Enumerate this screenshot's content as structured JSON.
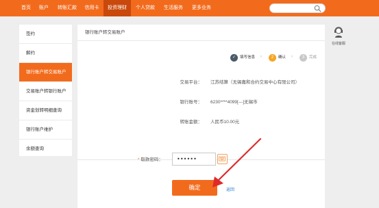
{
  "nav": {
    "items": [
      "首页",
      "账户",
      "转账汇款",
      "信用卡",
      "投资理财",
      "个人贷款",
      "生活服务",
      "更多业务"
    ],
    "active_index": 4
  },
  "search": {
    "placeholder": ""
  },
  "sidebar": {
    "items": [
      "签约",
      "解约",
      "银行账户转交易账户",
      "交易账户转银行账户",
      "资金划转明细查询",
      "银行账户维护",
      "余额查询"
    ],
    "active_index": 2
  },
  "panel": {
    "title": "银行账户转交易账户",
    "steps": [
      {
        "num": "✓",
        "label": "填写信息",
        "state": "done"
      },
      {
        "num": "2",
        "label": "确认",
        "state": "current"
      },
      {
        "num": "3",
        "label": "完成",
        "state": "pending"
      }
    ],
    "info": [
      {
        "label": "交易平台：",
        "value": "江苏结算（无锡嘉和合约交易中心有限公司）"
      },
      {
        "label": "银行账号：",
        "value": "6230****4099[---]无锡市"
      },
      {
        "label": "转账金额：",
        "value": "人民币10.00元"
      }
    ],
    "password": {
      "label": "取款密码：",
      "value": "••••••"
    },
    "confirm_label": "确定",
    "back_label": "返回"
  },
  "cs": {
    "label": "在线客服"
  },
  "colors": {
    "accent": "#f26b1d",
    "active_nav": "#c9480b",
    "link": "#2e7fd0",
    "step_done": "#4a5a6a",
    "step_pending": "#c8c8c8"
  }
}
